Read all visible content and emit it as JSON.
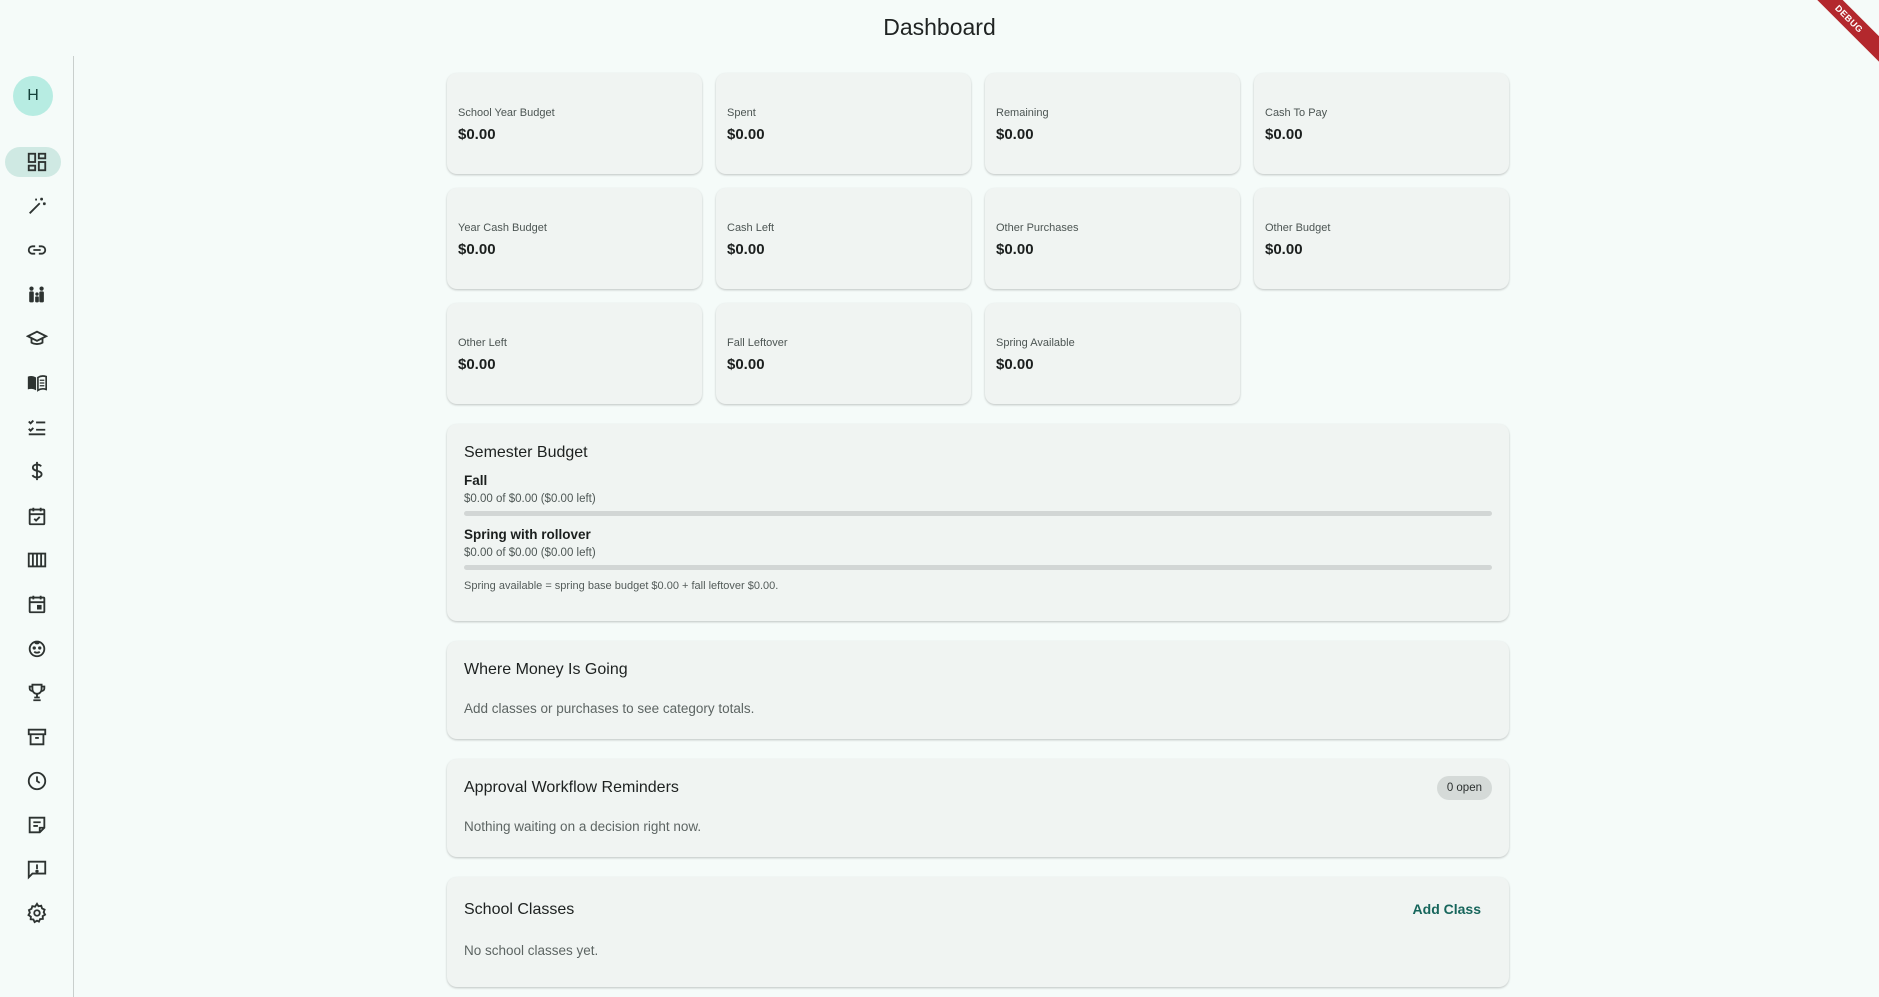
{
  "header": {
    "title": "Dashboard",
    "debug_banner": "DEBUG"
  },
  "user": {
    "avatar_initial": "H"
  },
  "nav": {
    "items": [
      {
        "icon": "dashboard-icon",
        "active": true
      },
      {
        "icon": "magic-wand-icon"
      },
      {
        "icon": "link-icon"
      },
      {
        "icon": "family-icon"
      },
      {
        "icon": "graduation-cap-icon"
      },
      {
        "icon": "book-icon"
      },
      {
        "icon": "checklist-icon"
      },
      {
        "icon": "dollar-icon"
      },
      {
        "icon": "calendar-check-icon"
      },
      {
        "icon": "columns-icon"
      },
      {
        "icon": "calendar-icon"
      },
      {
        "icon": "child-face-icon"
      },
      {
        "icon": "trophy-icon"
      },
      {
        "icon": "archive-icon"
      },
      {
        "icon": "clock-icon"
      },
      {
        "icon": "note-icon"
      },
      {
        "icon": "feedback-icon"
      },
      {
        "icon": "gear-icon"
      }
    ]
  },
  "stats": [
    {
      "label": "School Year Budget",
      "value": "$0.00"
    },
    {
      "label": "Spent",
      "value": "$0.00"
    },
    {
      "label": "Remaining",
      "value": "$0.00"
    },
    {
      "label": "Cash To Pay",
      "value": "$0.00"
    },
    {
      "label": "Year Cash Budget",
      "value": "$0.00"
    },
    {
      "label": "Cash Left",
      "value": "$0.00"
    },
    {
      "label": "Other Purchases",
      "value": "$0.00"
    },
    {
      "label": "Other Budget",
      "value": "$0.00"
    },
    {
      "label": "Other Left",
      "value": "$0.00"
    },
    {
      "label": "Fall Leftover",
      "value": "$0.00"
    },
    {
      "label": "Spring Available",
      "value": "$0.00"
    }
  ],
  "semester": {
    "title": "Semester Budget",
    "rows": [
      {
        "name": "Fall",
        "detail": "$0.00 of $0.00 ($0.00 left)",
        "progress": 0
      },
      {
        "name": "Spring with rollover",
        "detail": "$0.00 of $0.00 ($0.00 left)",
        "progress": 0
      }
    ],
    "note": "Spring available = spring base budget $0.00 + fall leftover $0.00."
  },
  "money": {
    "title": "Where Money Is Going",
    "empty": "Add classes or purchases to see category totals."
  },
  "approvals": {
    "title": "Approval Workflow Reminders",
    "badge": "0 open",
    "empty": "Nothing waiting on a decision right now."
  },
  "classes": {
    "title": "School Classes",
    "add_label": "Add Class",
    "empty": "No school classes yet."
  },
  "colors": {
    "accent": "#17665c",
    "active_nav": "#cfe9e3",
    "avatar": "#b7ece2"
  }
}
